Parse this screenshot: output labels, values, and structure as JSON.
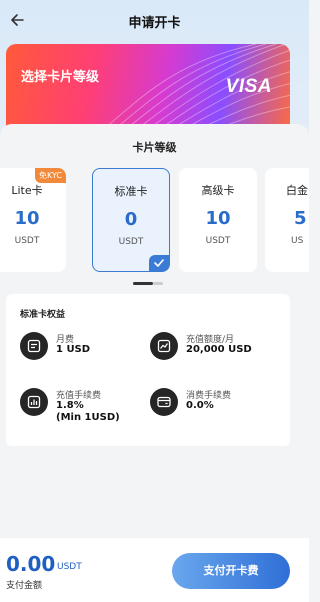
{
  "header": {
    "title": "申请开卡"
  },
  "banner": {
    "title": "选择卡片等级",
    "brand": "VISA"
  },
  "sheet": {
    "title": "卡片等级"
  },
  "tiers": [
    {
      "name": "Lite卡",
      "price": "10",
      "unit": "USDT",
      "badge": "免KYC"
    },
    {
      "name": "标准卡",
      "price": "0",
      "unit": "USDT",
      "selected": true
    },
    {
      "name": "高级卡",
      "price": "10",
      "unit": "USDT"
    },
    {
      "name": "白金",
      "price": "5",
      "unit": "US"
    }
  ],
  "benefits": {
    "title": "标准卡权益",
    "items": [
      {
        "label": "月费",
        "value": "1 USD",
        "icon": "card-fee-icon"
      },
      {
        "label": "充值额度/月",
        "value": "20,000 USD",
        "icon": "chart-icon"
      },
      {
        "label": "充值手续费",
        "value": "1.8%\n(Min 1USD)",
        "icon": "bar-chart-icon"
      },
      {
        "label": "消费手续费",
        "value": "0.0%",
        "icon": "wallet-card-icon"
      }
    ]
  },
  "footer": {
    "amount": "0.00",
    "amount_unit": "USDT",
    "amount_label": "支付金额",
    "pay_button": "支付开卡费"
  },
  "colors": {
    "accent": "#2f6fd6",
    "price": "#2a6cc9",
    "badge": "#f08a3a"
  }
}
